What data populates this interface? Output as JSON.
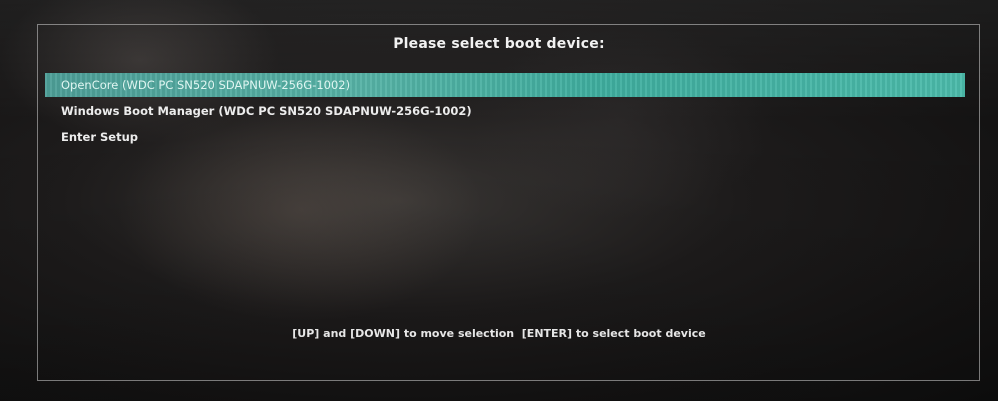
{
  "boot_menu": {
    "title": "Please select boot device:",
    "items": [
      {
        "label": "OpenCore (WDC PC SN520 SDAPNUW-256G-1002)",
        "selected": true
      },
      {
        "label": "Windows Boot Manager (WDC PC SN520 SDAPNUW-256G-1002)",
        "selected": false
      },
      {
        "label": "Enter Setup",
        "selected": false
      }
    ],
    "hint": "[UP] and [DOWN] to move selection  [ENTER] to select boot device"
  },
  "colors": {
    "selection_highlight": "#4cb3a6",
    "text": "#ececec",
    "frame": "#d2d2d2",
    "background": "#1a1919"
  }
}
